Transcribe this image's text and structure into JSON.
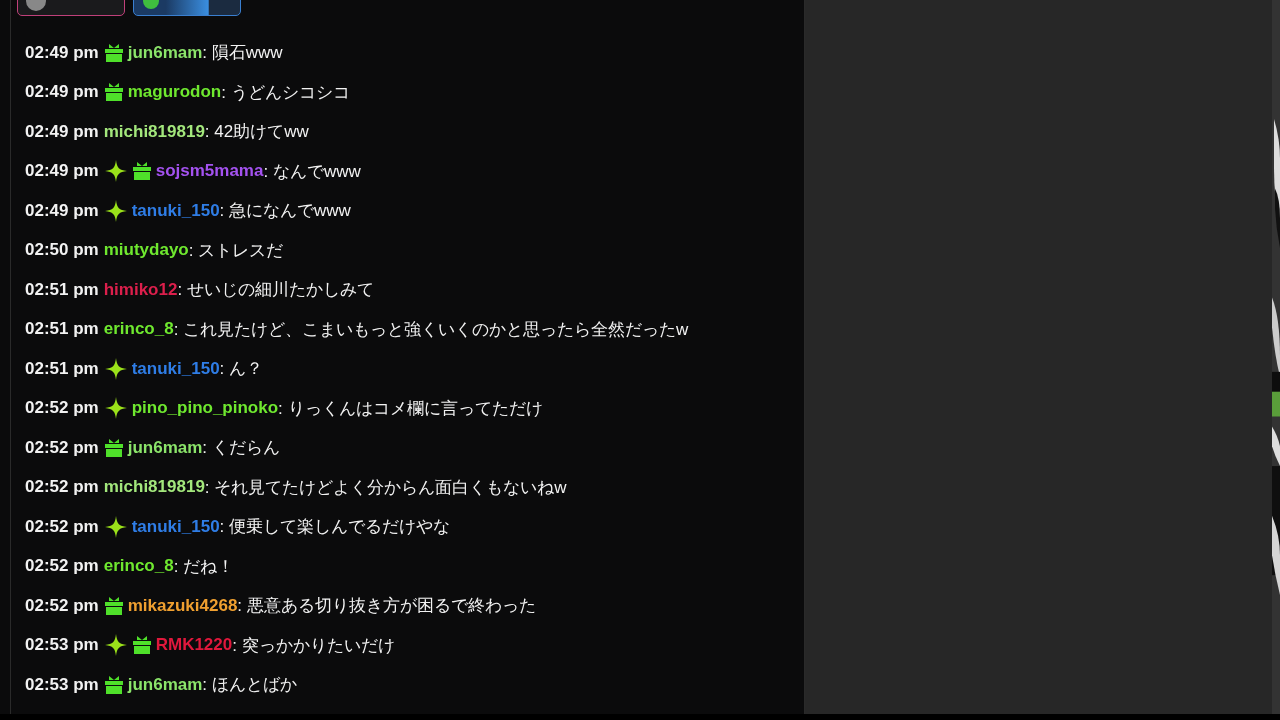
{
  "top_badges": [
    {
      "kind": "avatar",
      "color": "#c0407a"
    },
    {
      "kind": "gem",
      "color": "#3a7fd0"
    }
  ],
  "messages": [
    {
      "time": "02:49 pm",
      "badges": [
        {
          "kind": "gift"
        }
      ],
      "user": "jun6mam",
      "color": "#8be46a",
      "text": ": 隕石www"
    },
    {
      "time": "02:49 pm",
      "badges": [
        {
          "kind": "gift"
        }
      ],
      "user": "magurodon",
      "color": "#6fe82f",
      "text": ": うどんシコシコ"
    },
    {
      "time": "02:49 pm",
      "user": "michi819819",
      "color": "#a3e77c",
      "text": ": 42助けてww"
    },
    {
      "time": "02:49 pm",
      "badges": [
        {
          "kind": "sparkle"
        },
        {
          "kind": "gift"
        }
      ],
      "user": "sojsm5mama",
      "color": "#a452f0",
      "text": ": なんでwww"
    },
    {
      "time": "02:49 pm",
      "badges": [
        {
          "kind": "sparkle"
        }
      ],
      "user": "tanuki_150",
      "color": "#2f7de6",
      "text": ": 急になんでwww"
    },
    {
      "time": "02:50 pm",
      "user": "miutydayo",
      "color": "#6fe82f",
      "text": ": ストレスだ"
    },
    {
      "time": "02:51 pm",
      "user": "himiko12",
      "color": "#dc1f4c",
      "text": ": せいじの細川たかしみて"
    },
    {
      "time": "02:51 pm",
      "user": "erinco_8",
      "color": "#6fe82f",
      "text": ": これ見たけど、こまいもっと強くいくのかと思ったら全然だったw"
    },
    {
      "time": "02:51 pm",
      "badges": [
        {
          "kind": "sparkle"
        }
      ],
      "user": "tanuki_150",
      "color": "#2f7de6",
      "text": ": ん？"
    },
    {
      "time": "02:52 pm",
      "badges": [
        {
          "kind": "sparkle"
        }
      ],
      "user": "pino_pino_pinoko",
      "color": "#6fe82f",
      "text": ": りっくんはコメ欄に言ってただけ"
    },
    {
      "time": "02:52 pm",
      "badges": [
        {
          "kind": "gift"
        }
      ],
      "user": "jun6mam",
      "color": "#8be46a",
      "text": ": くだらん"
    },
    {
      "time": "02:52 pm",
      "user": "michi819819",
      "color": "#a3e77c",
      "text": ": それ見てたけどよく分からん面白くもないねw"
    },
    {
      "time": "02:52 pm",
      "badges": [
        {
          "kind": "sparkle"
        }
      ],
      "user": "tanuki_150",
      "color": "#2f7de6",
      "text": ": 便乗して楽しんでるだけやな"
    },
    {
      "time": "02:52 pm",
      "user": "erinco_8",
      "color": "#6fe82f",
      "text": ": だね！"
    },
    {
      "time": "02:52 pm",
      "badges": [
        {
          "kind": "gift"
        }
      ],
      "user": "mikazuki4268",
      "color": "#f0a030",
      "text": ": 悪意ある切り抜き方が困るで終わった"
    },
    {
      "time": "02:53 pm",
      "badges": [
        {
          "kind": "sparkle"
        },
        {
          "kind": "gift"
        }
      ],
      "user": "RMK1220",
      "color": "#e0183c",
      "text": ": 突っかかりたいだけ"
    },
    {
      "time": "02:53 pm",
      "badges": [
        {
          "kind": "gift"
        }
      ],
      "user": "jun6mam",
      "color": "#8be46a",
      "text": ": ほんとばか"
    }
  ]
}
